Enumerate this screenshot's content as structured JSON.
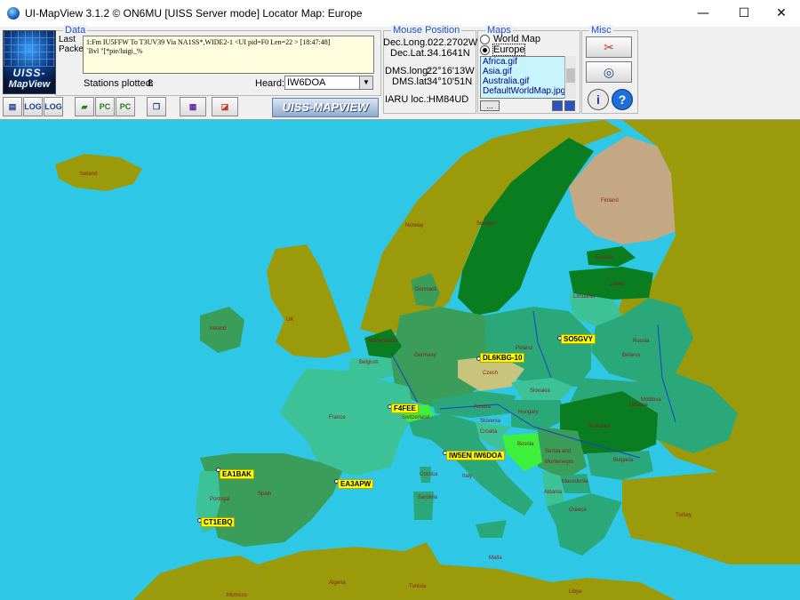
{
  "window": {
    "title": "UI-MapView 3.1.2 © ON6MU  [UISS Server mode]  Locator Map: Europe",
    "min_glyph": "—",
    "max_glyph": "☐",
    "close_glyph": "✕"
  },
  "data_panel": {
    "group_title": "Data",
    "logo_line1": "UISS-",
    "logo_line2": "MapView",
    "last_label": "Last",
    "packet_label": "Packet:",
    "packet_text": "1:Fm IU5FFW To T3UV39 Via NA1SS*,WIDE2-1 <UI pid=F0 Len=22 > [18:47:48]\n`Bvl \"[*pie/luigi_%",
    "stations_plotted_label": "Stations plotted:",
    "stations_plotted_value": "8",
    "heard_label": "Heard:",
    "heard_value": "IW6DOA",
    "brand": "UISS-MAPVIEW"
  },
  "toolbar": {
    "buttons": [
      "open",
      "LOG",
      "LOG",
      "open-folder",
      "PC",
      "PC",
      "copy",
      "map",
      "erase"
    ]
  },
  "mouse_position": {
    "group_title": "Mouse Position",
    "dec_long_label": "Dec.Long.:",
    "dec_long_value": "022.2702W",
    "dec_lat_label": "Dec.Lat.:",
    "dec_lat_value": "34.1641N",
    "dms_long_label": "DMS.long:",
    "dms_long_value": "22°16'13W",
    "dms_lat_label": "DMS.lat:",
    "dms_lat_value": "34°10'51N",
    "iaru_label": "IARU loc.:",
    "iaru_value": "HM84UD"
  },
  "maps": {
    "group_title": "Maps",
    "radio_world": "World Map",
    "radio_europe": "Europe",
    "selected": "Europe",
    "files": [
      "Africa.gif",
      "Asia.gif",
      "Australia.gif",
      "DefaultWorldMap.jpg"
    ],
    "more_button": "..."
  },
  "misc": {
    "group_title": "Misc",
    "info_glyph": "i",
    "help_glyph": "?"
  },
  "map": {
    "countries": [
      "Iceland",
      "Norway",
      "Sweden",
      "Finland",
      "Estonia",
      "Latvia",
      "Lithuania",
      "Denmark",
      "UK",
      "Ireland",
      "Netherlands",
      "Belgium",
      "Germany",
      "Poland",
      "Russia",
      "Belarus",
      "Ukraine",
      "Czech",
      "Slovakia",
      "Austria",
      "Hungary",
      "Romania",
      "Moldova",
      "Bulgaria",
      "Serbia and",
      "Montenegro",
      "Macedonia",
      "Albania",
      "Greece",
      "Turkey",
      "France",
      "Switzerland",
      "Italy",
      "Bosnia",
      "Croatia",
      "Slovenia",
      "Spain",
      "Portugal",
      "Corsica",
      "Sardinia",
      "Malta",
      "Algeria",
      "Tunisia",
      "Morocco",
      "Libya"
    ],
    "stations": [
      "EA1BAK",
      "EA3APW",
      "CT1EBQ",
      "F4FEE",
      "DL6KBG-10",
      "SO5GVY",
      "IW5EN",
      "IW6DOA"
    ],
    "colors": {
      "sea": "#2ec8e6",
      "olive": "#9a9a0b",
      "bright_green": "#18b418",
      "dark_green": "#0a7d20",
      "tan": "#c4a883",
      "teal": "#2aa87a",
      "seafoam": "#3cc296",
      "mid_green": "#3a9d5a",
      "khaki": "#c8c47e",
      "lime": "#3cf03c",
      "station_yellow": "#ffff00"
    }
  }
}
